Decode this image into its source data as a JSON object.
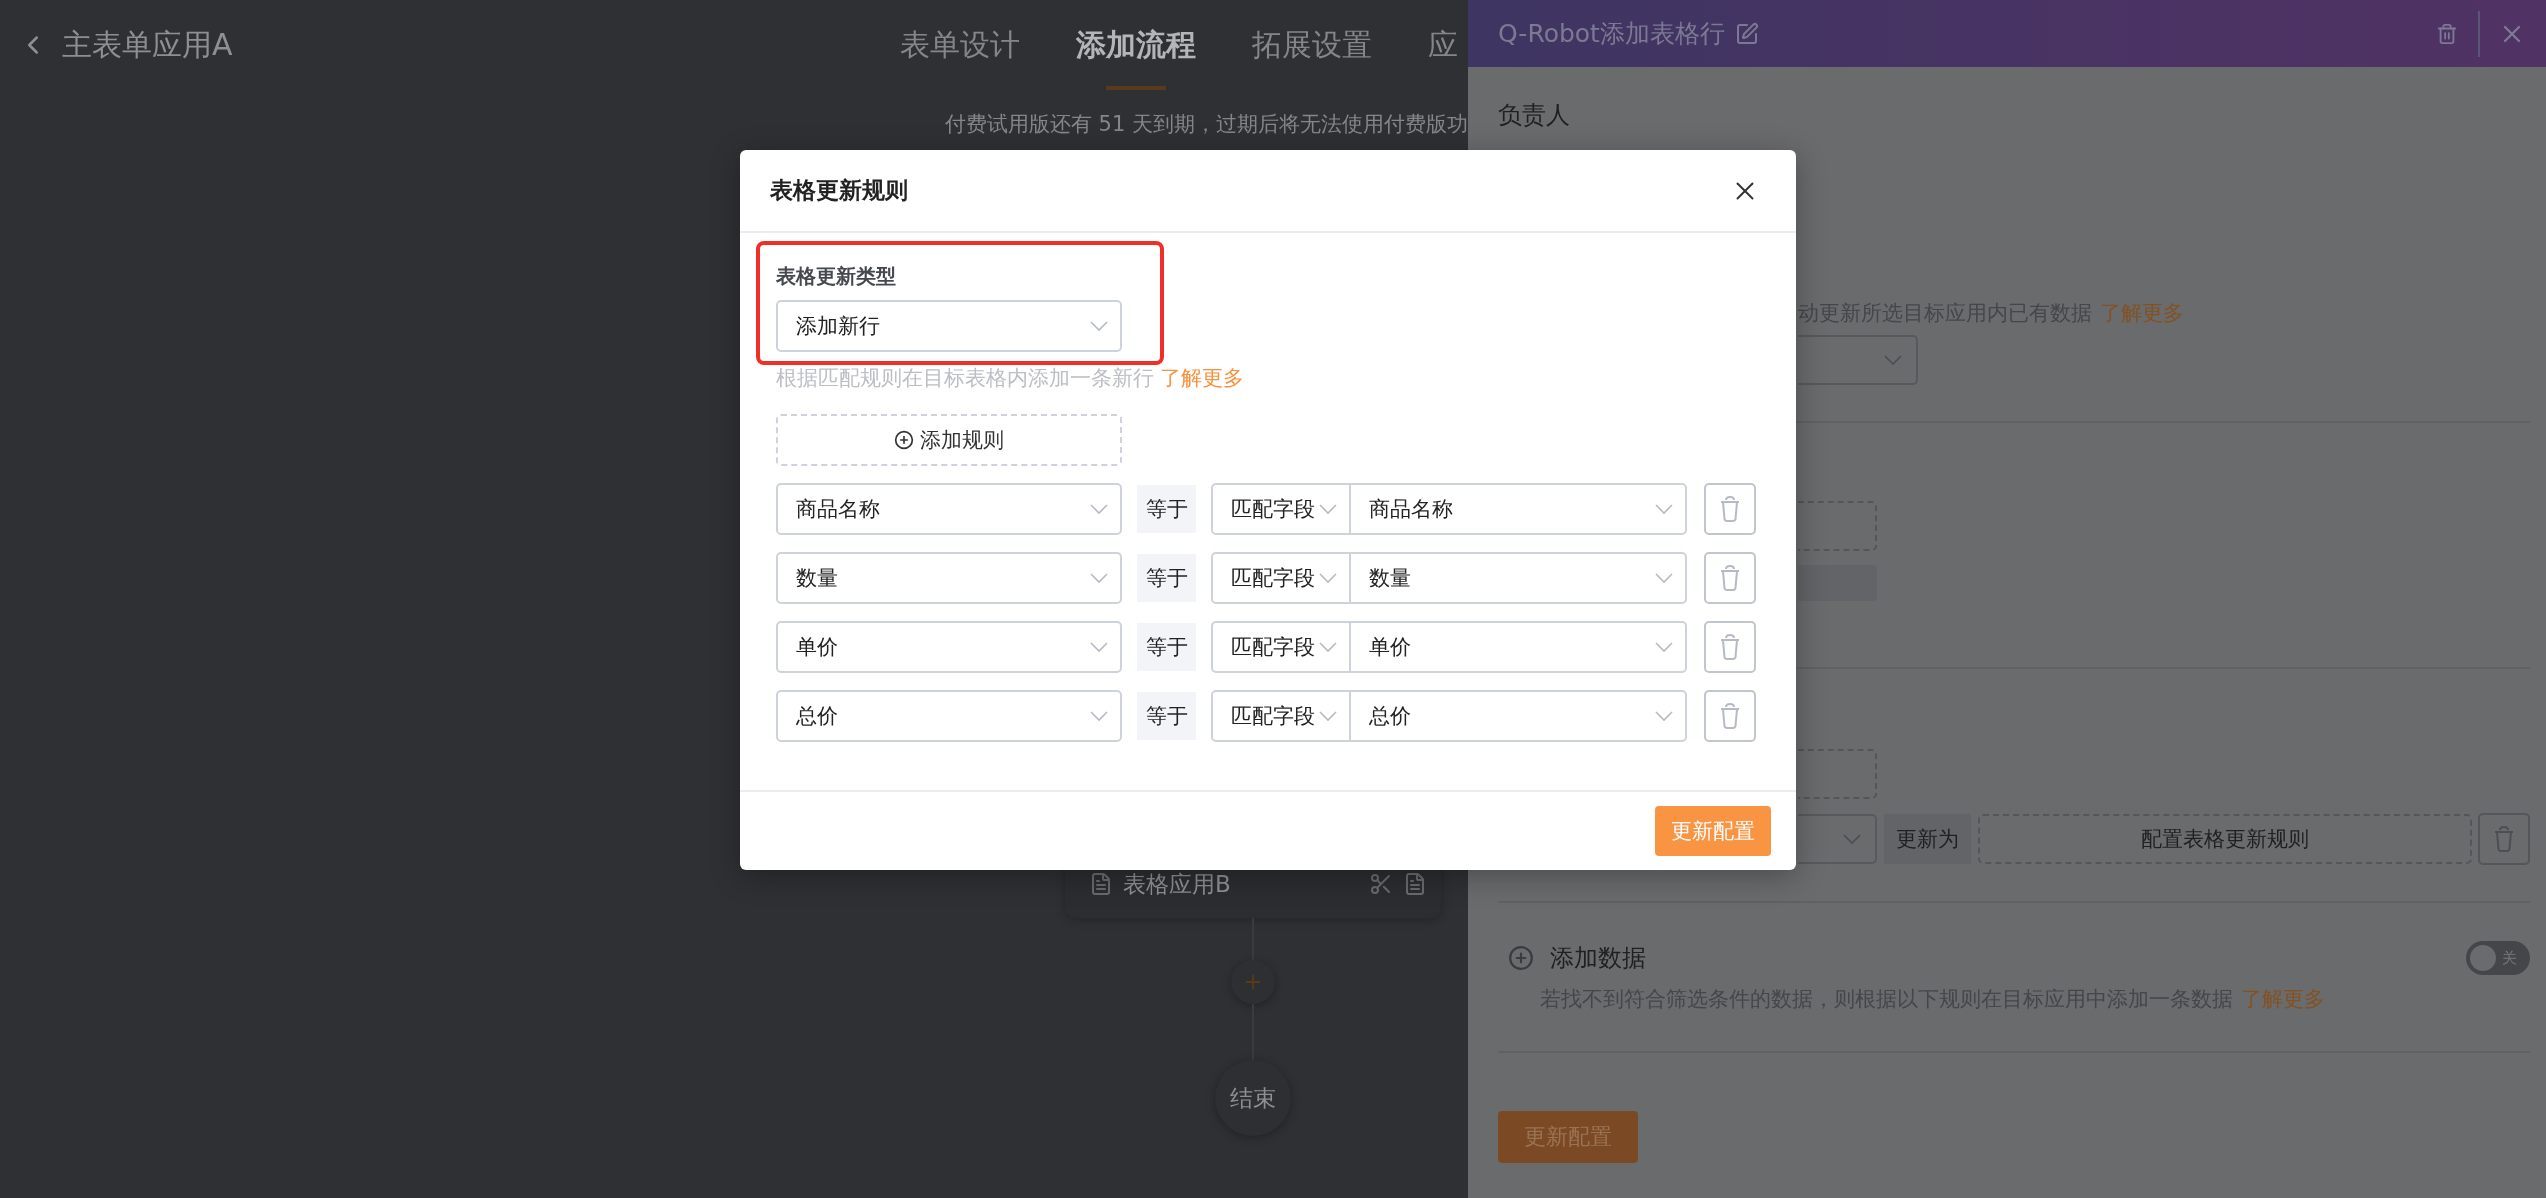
{
  "app": {
    "title": "主表单应用A",
    "tabs": [
      {
        "label": "表单设计",
        "selected": false
      },
      {
        "label": "添加流程",
        "selected": true
      },
      {
        "label": "拓展设置",
        "selected": false
      },
      {
        "label": "应",
        "selected": false
      }
    ],
    "notice": "付费试用版还有 51 天到期，过期后将无法使用付费版功"
  },
  "flow": {
    "node": "表格应用B",
    "end": "结束"
  },
  "drawer": {
    "title": "Q-Robot添加表格行",
    "owner_label": "负责人",
    "update_hint": "动更新所选目标应用内已有数据",
    "update_link": "了解更多",
    "rule_row": {
      "operator": "更新为",
      "config": "配置表格更新规则"
    },
    "add_data": {
      "title": "添加数据",
      "on": false,
      "toggle_label": "关",
      "description": "若找不到符合筛选条件的数据，则根据以下规则在目标应用中添加一条数据",
      "link": "了解更多"
    },
    "submit": "更新配置"
  },
  "dialog": {
    "title": "表格更新规则",
    "type_label": "表格更新类型",
    "type_value": "添加新行",
    "highlighted": true,
    "hint": "根据匹配规则在目标表格内添加一条新行",
    "hint_link": "了解更多",
    "add_rule": "添加规则",
    "rules": [
      {
        "field": "商品名称",
        "operator": "等于",
        "match_type": "匹配字段",
        "value": "商品名称"
      },
      {
        "field": "数量",
        "operator": "等于",
        "match_type": "匹配字段",
        "value": "数量"
      },
      {
        "field": "单价",
        "operator": "等于",
        "match_type": "匹配字段",
        "value": "单价"
      },
      {
        "field": "总价",
        "operator": "等于",
        "match_type": "匹配字段",
        "value": "总价"
      }
    ],
    "submit": "更新配置"
  }
}
